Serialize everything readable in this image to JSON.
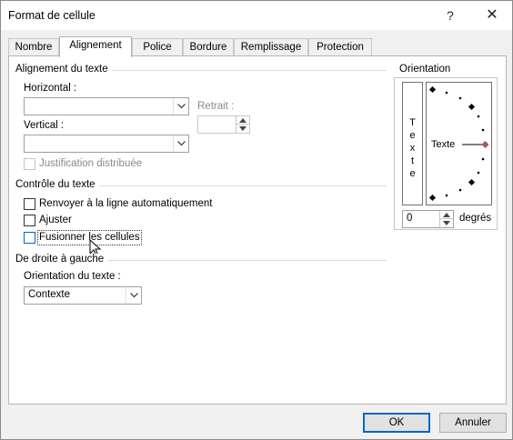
{
  "window": {
    "title": "Format de cellule",
    "help_icon": "?",
    "close_icon": "✕"
  },
  "tabs": [
    "Nombre",
    "Alignement",
    "Police",
    "Bordure",
    "Remplissage",
    "Protection"
  ],
  "active_tab": "Alignement",
  "text_alignment": {
    "group_title": "Alignement du texte",
    "horizontal_label": "Horizontal :",
    "horizontal_value": "",
    "indent_label": "Retrait :",
    "indent_value": "",
    "vertical_label": "Vertical :",
    "vertical_value": "",
    "distributed_label": "Justification distribuée"
  },
  "text_control": {
    "group_title": "Contrôle du texte",
    "wrap_label": "Renvoyer à la ligne automatiquement",
    "shrink_label": "Ajuster",
    "merge_label": "Fusionner les cellules"
  },
  "rtl": {
    "group_title": "De droite à gauche",
    "direction_label": "Orientation du texte :",
    "direction_value": "Contexte"
  },
  "orientation": {
    "group_title": "Orientation",
    "vertical_letters": [
      "T",
      "e",
      "x",
      "t",
      "e"
    ],
    "dial_text": "Texte",
    "degrees_value": "0",
    "degrees_label": "degrés"
  },
  "buttons": {
    "ok": "OK",
    "cancel": "Annuler"
  },
  "colors": {
    "accent": "#0067c0",
    "dial_marker": "#c0504d"
  }
}
